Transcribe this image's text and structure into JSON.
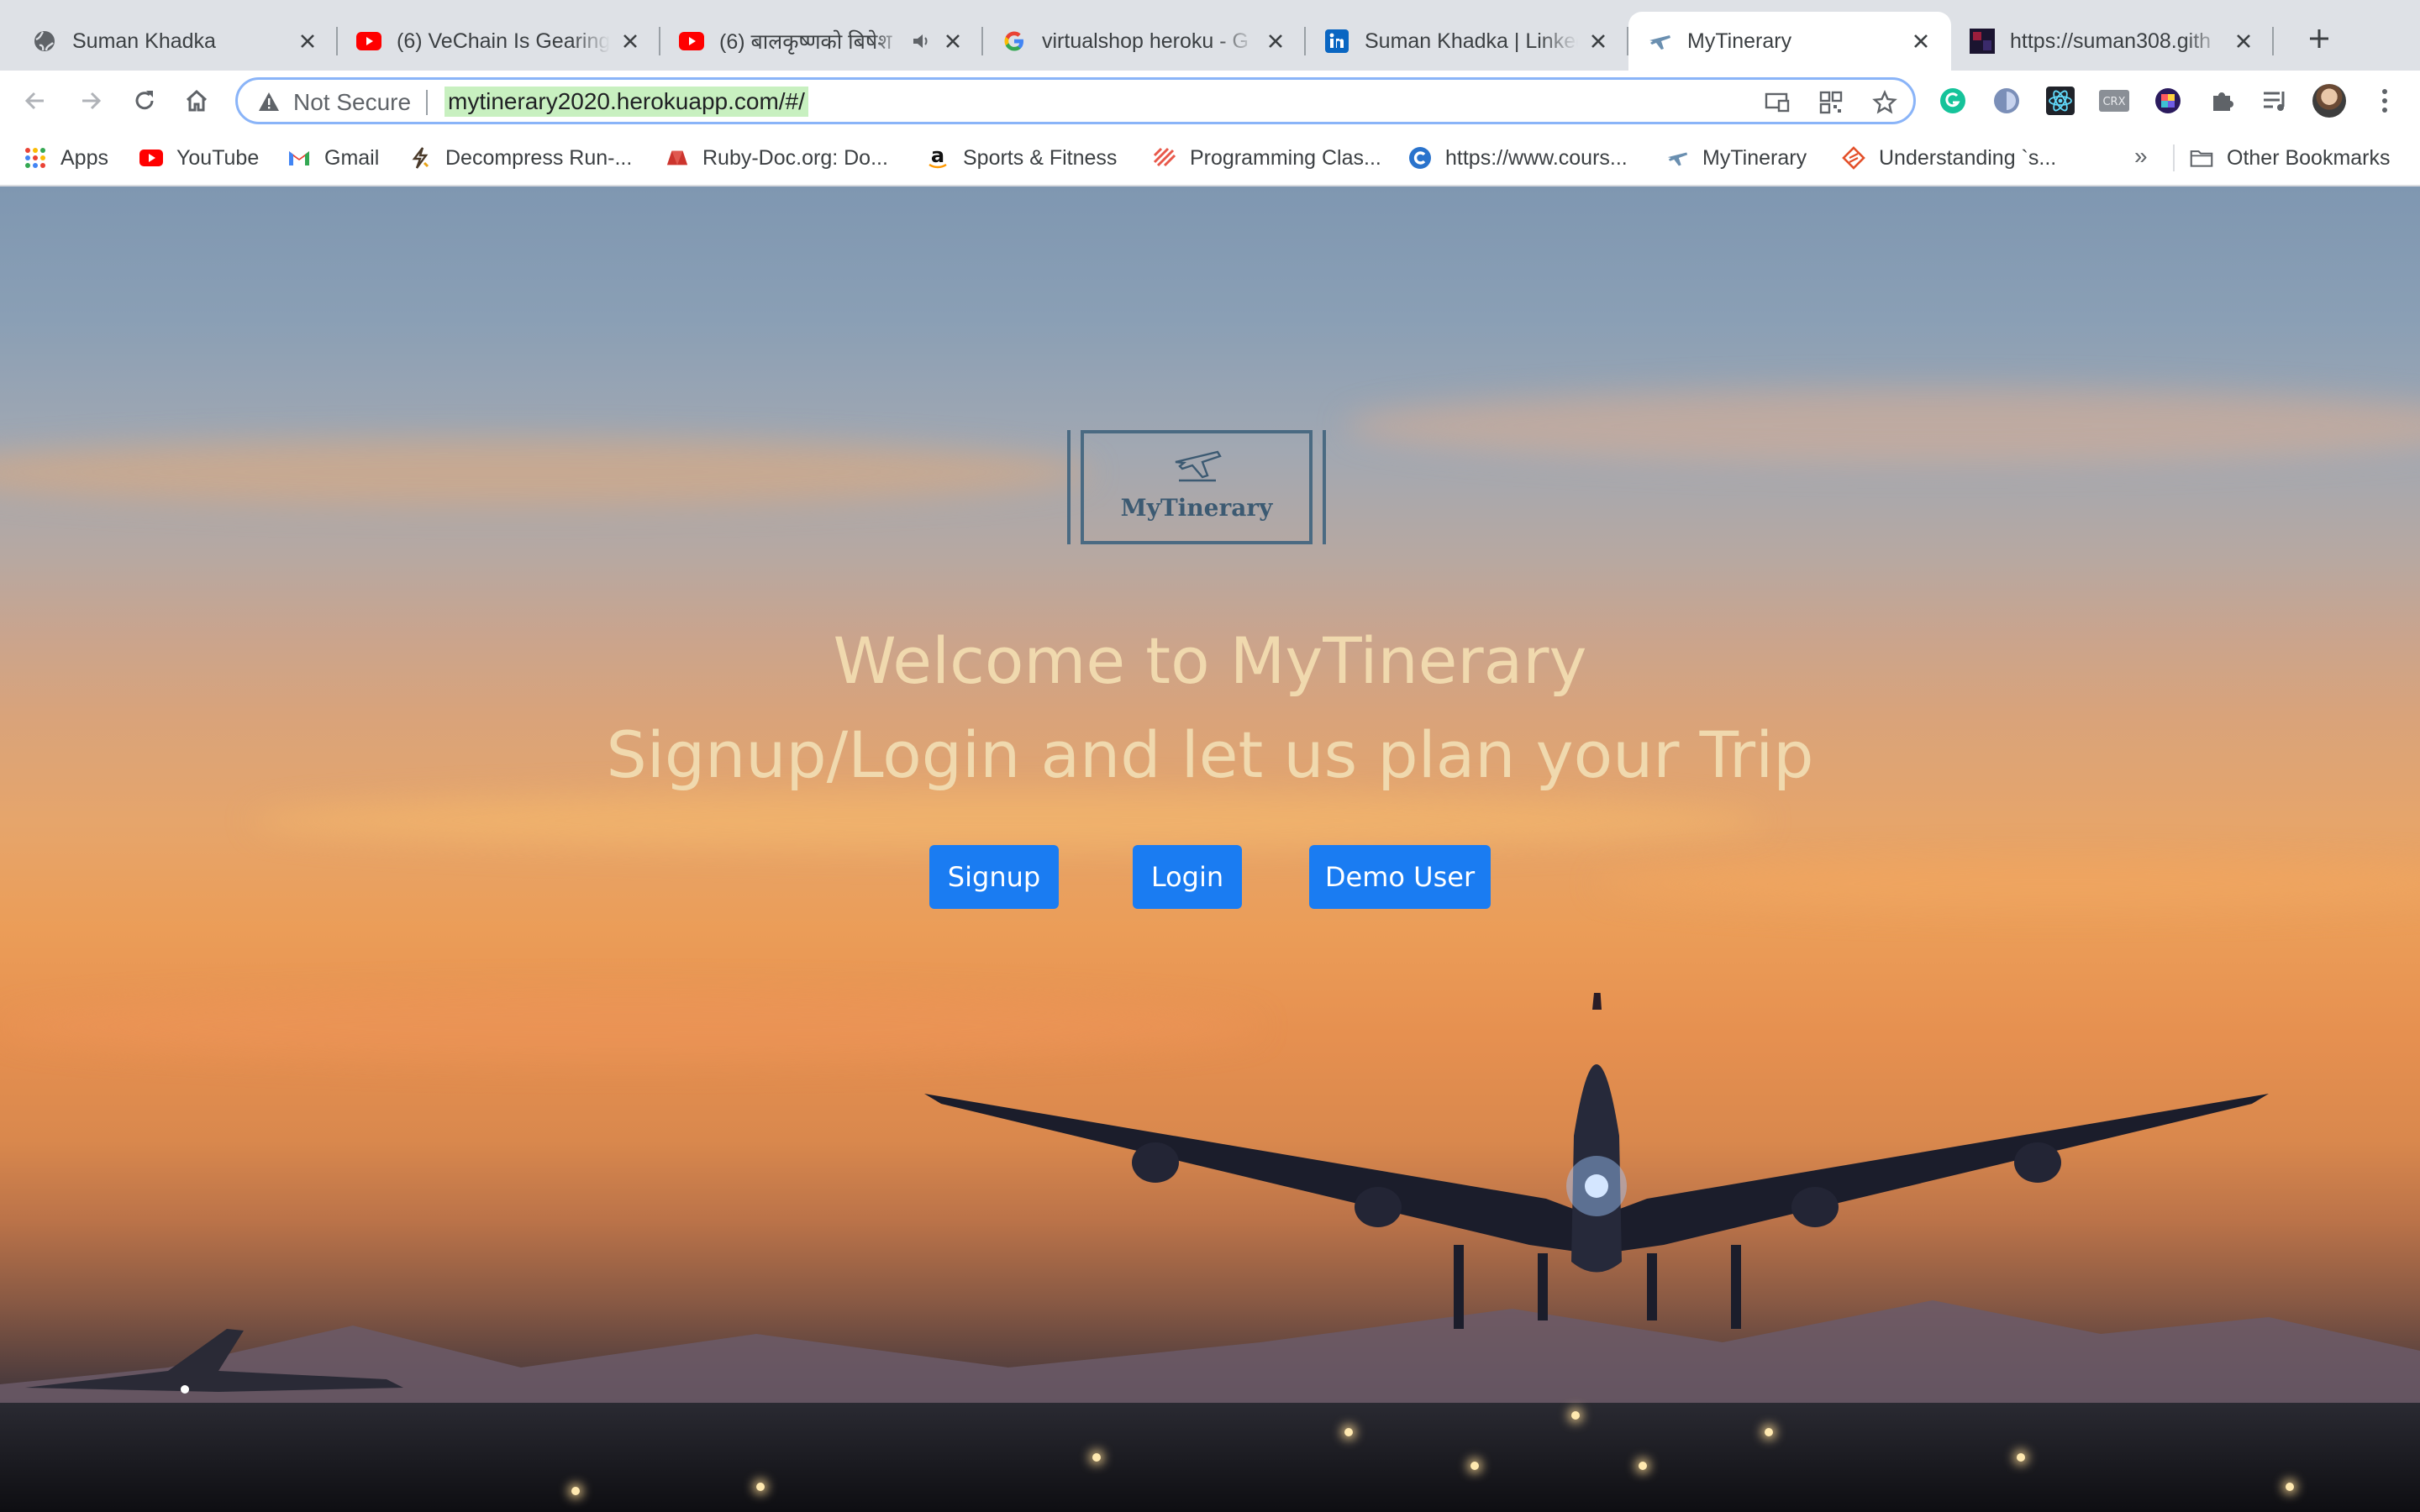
{
  "browser": {
    "tabs": [
      {
        "title": "Suman Khadka",
        "icon": "globe-icon"
      },
      {
        "title": "(6) VeChain Is Gearing",
        "icon": "youtube-icon"
      },
      {
        "title": "(6) बालकृष्णको बिषेश",
        "icon": "youtube-icon",
        "muted": true
      },
      {
        "title": "virtualshop heroku - G",
        "icon": "google-icon"
      },
      {
        "title": "Suman Khadka | Linked",
        "icon": "linkedin-icon"
      },
      {
        "title": "MyTinerary",
        "icon": "airplane-icon",
        "active": true
      },
      {
        "title": "https://suman308.gith",
        "icon": "github-pages-icon"
      }
    ],
    "security_label": "Not Secure",
    "url": "mytinerary2020.herokuapp.com/#/"
  },
  "bookmarks": [
    {
      "label": "Apps",
      "icon": "apps-grid-icon"
    },
    {
      "label": "YouTube",
      "icon": "youtube-icon"
    },
    {
      "label": "Gmail",
      "icon": "gmail-icon"
    },
    {
      "label": "Decompress Run-...",
      "icon": "bolt-icon"
    },
    {
      "label": "Ruby-Doc.org: Do...",
      "icon": "ruby-icon"
    },
    {
      "label": "Sports & Fitness",
      "icon": "amazon-icon"
    },
    {
      "label": "Programming Clas...",
      "icon": "stripes-icon"
    },
    {
      "label": "https://www.cours...",
      "icon": "coursera-icon"
    },
    {
      "label": "MyTinerary",
      "icon": "airplane-icon"
    },
    {
      "label": "Understanding `s...",
      "icon": "diamond-icon"
    }
  ],
  "bookmarks_more": "»",
  "other_bookmarks": "Other Bookmarks",
  "page": {
    "logo_text": "MyTinerary",
    "welcome": "Welcome to MyTinerary",
    "subtitle": "Signup/Login and let us plan your Trip",
    "buttons": {
      "signup": "Signup",
      "login": "Login",
      "demo": "Demo User"
    }
  },
  "colors": {
    "button": "#1a7cf2",
    "hero_text": "#f0d9ae",
    "logo": "#4a6a82"
  }
}
